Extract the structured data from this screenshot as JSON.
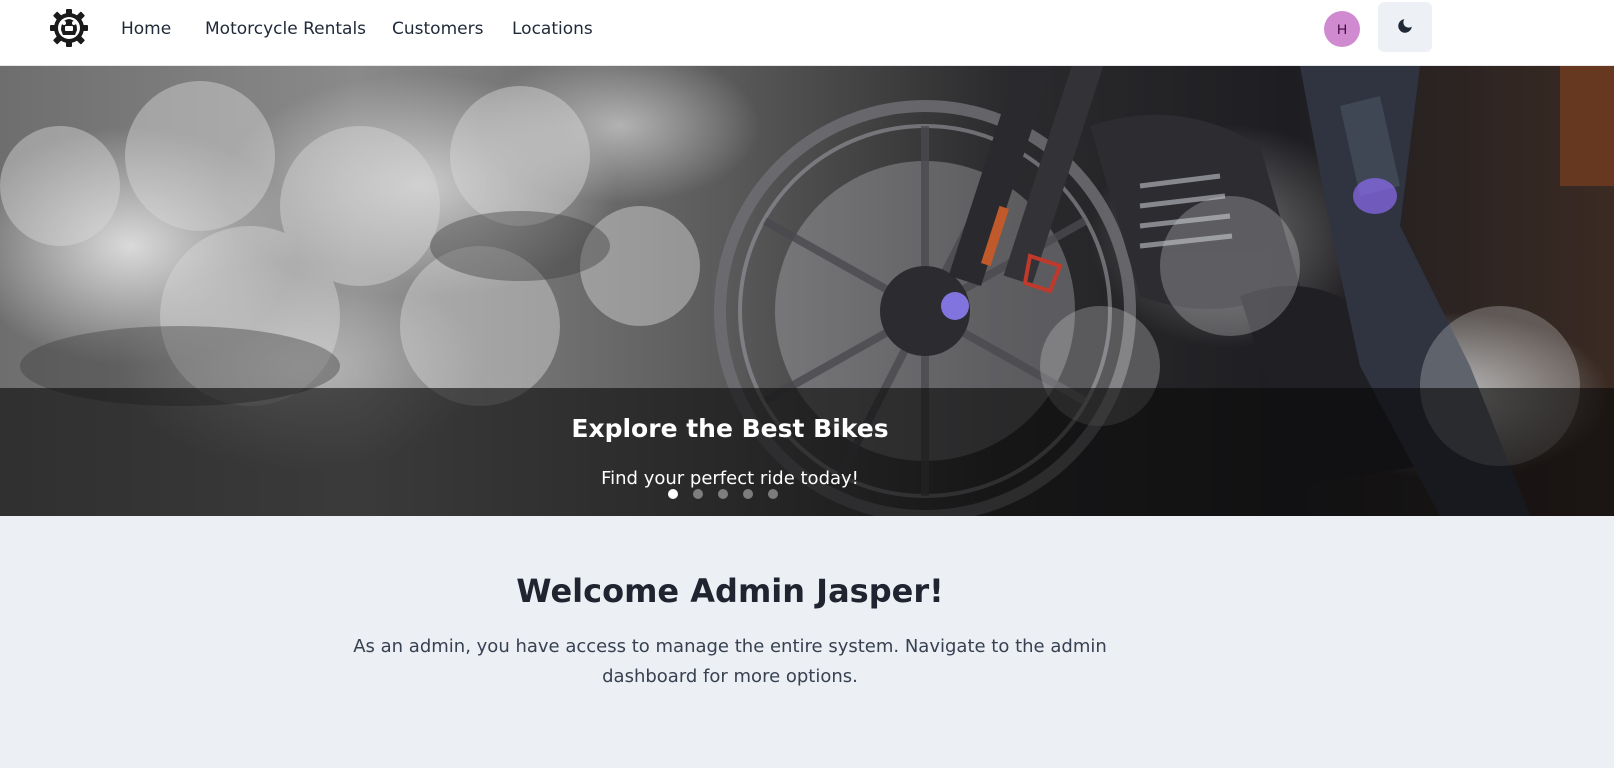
{
  "nav": {
    "links": [
      {
        "label": "Home"
      },
      {
        "label": "Motorcycle Rentals"
      },
      {
        "label": "Customers"
      },
      {
        "label": "Locations"
      }
    ],
    "avatar_initial": "H",
    "logo_icon": "helmet-gear-logo-icon",
    "theme_icon": "moon-icon"
  },
  "hero": {
    "title": "Explore the Best Bikes",
    "subtitle": "Find your perfect ride today!",
    "slide_count": 5,
    "active_slide": 1
  },
  "welcome": {
    "heading": "Welcome Admin Jasper!",
    "description": "As an admin, you have access to manage the entire system. Navigate to the admin dashboard for more options."
  },
  "colors": {
    "avatar_bg": "#d08ad0",
    "content_bg": "#eceff3",
    "theme_button_bg": "#edf1f5"
  }
}
